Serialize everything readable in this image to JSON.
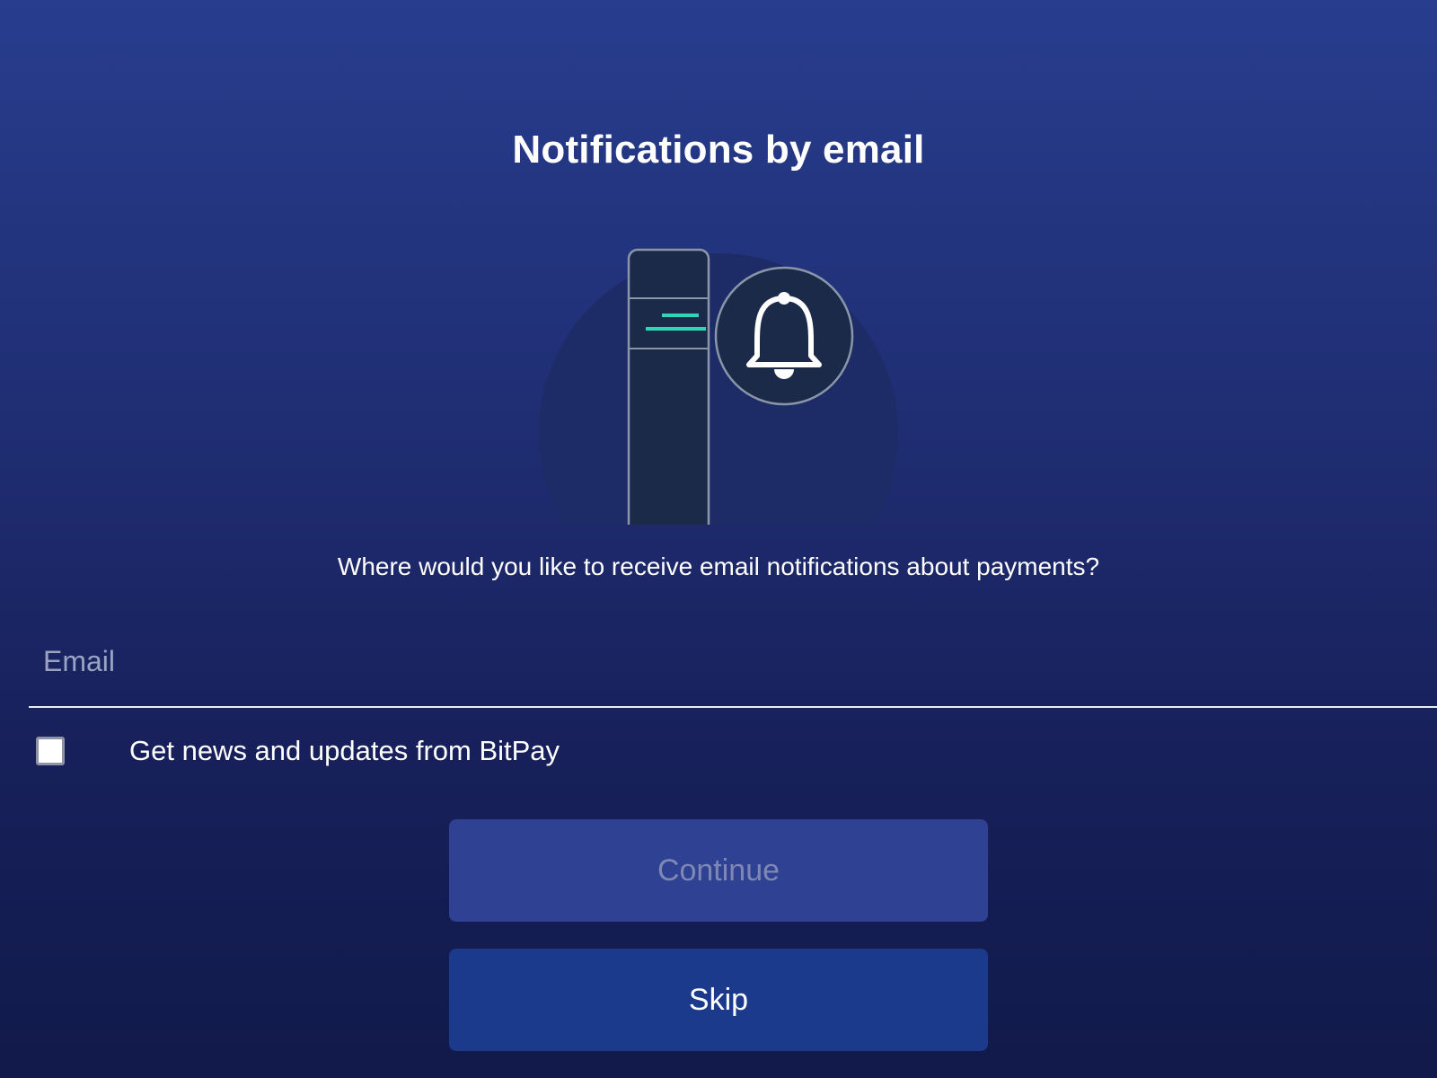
{
  "header": {
    "title": "Notifications by email"
  },
  "illustration": {
    "icon": "bell-icon",
    "accent_color": "#2fd6b5"
  },
  "main": {
    "prompt": "Where would you like to receive email notifications about payments?",
    "email_field": {
      "placeholder": "Email",
      "value": ""
    },
    "news_checkbox": {
      "label": "Get news and updates from BitPay",
      "checked": false
    }
  },
  "actions": {
    "continue_label": "Continue",
    "continue_enabled": false,
    "skip_label": "Skip"
  }
}
